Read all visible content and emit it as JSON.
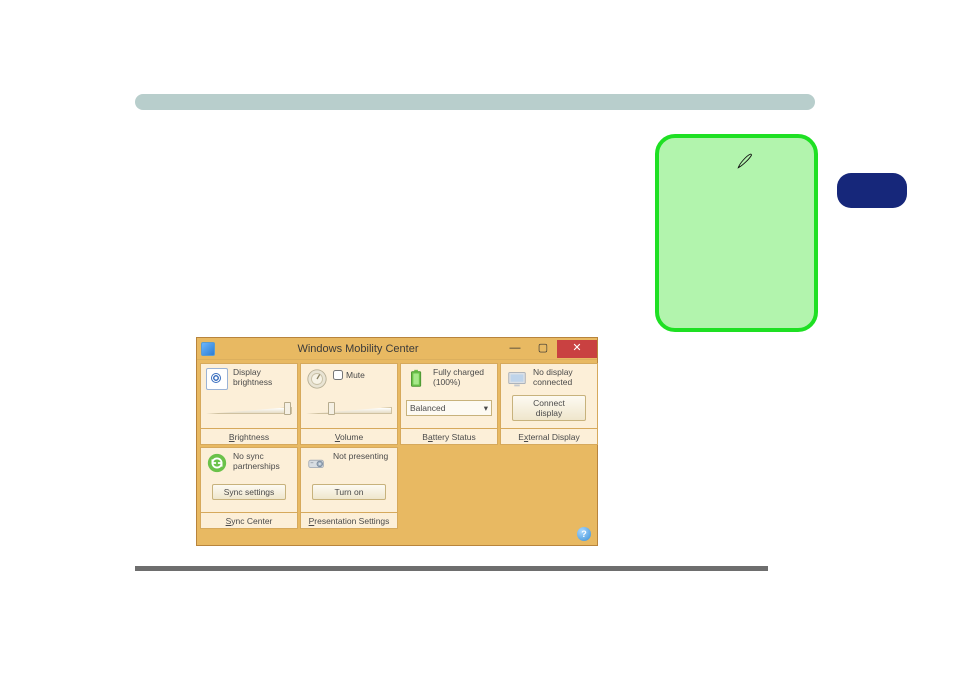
{
  "window": {
    "title": "Windows Mobility Center"
  },
  "tiles": {
    "brightness": {
      "label": "Display brightness",
      "footer": "Brightness",
      "slider_percent": 90
    },
    "volume": {
      "mute_label": "Mute",
      "footer": "Volume",
      "slider_percent": 28
    },
    "battery": {
      "label": "Fully charged (100%)",
      "select": "Balanced",
      "footer": "Battery Status"
    },
    "external": {
      "label": "No display connected",
      "button": "Connect display",
      "footer": "External Display"
    },
    "sync": {
      "label": "No sync partnerships",
      "button": "Sync settings",
      "footer": "Sync Center"
    },
    "presentation": {
      "label": "Not presenting",
      "button": "Turn on",
      "footer": "Presentation Settings"
    }
  },
  "help": "?"
}
